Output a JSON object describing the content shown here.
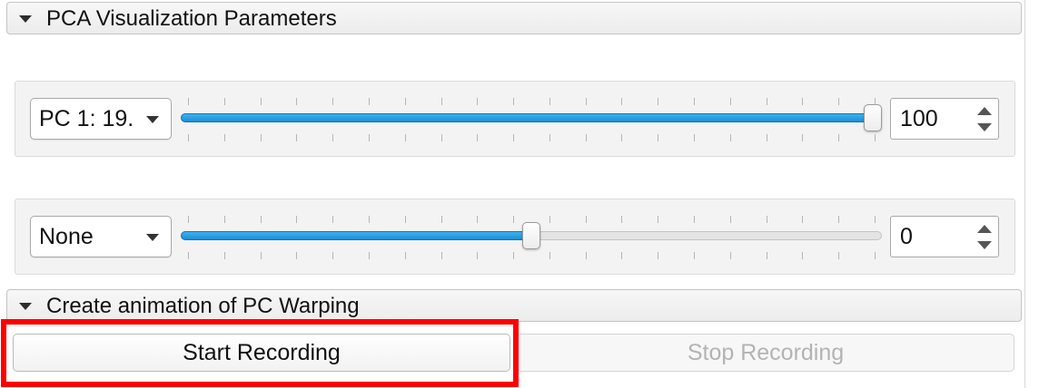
{
  "pca_section": {
    "title": "PCA Visualization Parameters"
  },
  "row1": {
    "combo_value": "PC 1: 19.",
    "slider_fraction": 1.0,
    "spin_value": "100"
  },
  "row2": {
    "combo_value": "None",
    "slider_fraction": 0.5,
    "spin_value": "0"
  },
  "animation_section": {
    "title": "Create animation of PC Warping"
  },
  "buttons": {
    "start_recording": "Start Recording",
    "stop_recording": "Stop Recording"
  },
  "colors": {
    "highlight": "#ff0000",
    "slider_fill": "#1a8fd8"
  }
}
